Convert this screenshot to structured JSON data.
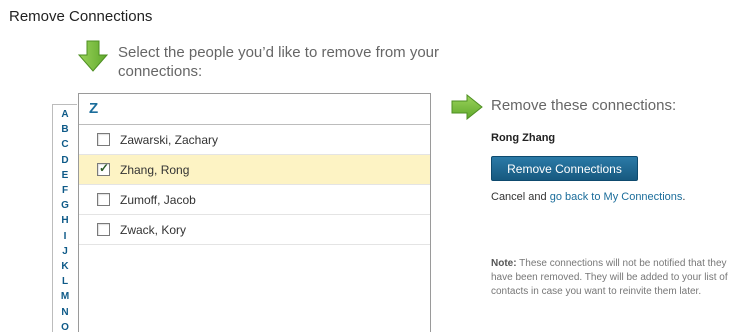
{
  "page": {
    "title": "Remove Connections"
  },
  "instruction": "Select the people you’d like to remove from your connections:",
  "alphabet": [
    "A",
    "B",
    "C",
    "D",
    "E",
    "F",
    "G",
    "H",
    "I",
    "J",
    "K",
    "L",
    "M",
    "N",
    "O"
  ],
  "list": {
    "header": "Z",
    "rows": [
      {
        "name": "Zawarski, Zachary",
        "checked": false
      },
      {
        "name": "Zhang, Rong",
        "checked": true
      },
      {
        "name": "Zumoff, Jacob",
        "checked": false
      },
      {
        "name": "Zwack, Kory",
        "checked": false
      }
    ]
  },
  "remove_panel": {
    "heading": "Remove these connections:",
    "selected_name": "Rong Zhang",
    "button_label": "Remove Connections",
    "cancel_text": "Cancel and",
    "cancel_link": "go back to My Connections",
    "cancel_suffix": "."
  },
  "note": {
    "label": "Note:",
    "text": "These connections will not be notified that they have been removed. They will be added to your list of contacts in case you want to reinvite them later."
  },
  "colors": {
    "accent": "#1b6d9b",
    "button": "#1e6a94",
    "selected_row": "#fdf3c4",
    "arrow_green": "#7cc242"
  },
  "icons": {
    "down_arrow": "green-down-arrow-icon",
    "right_arrow": "green-right-arrow-icon",
    "check": "checkmark-icon"
  }
}
